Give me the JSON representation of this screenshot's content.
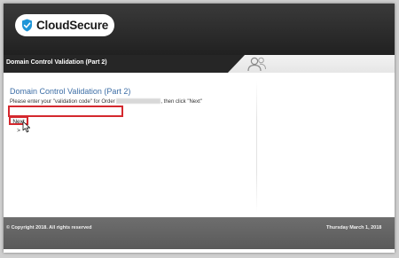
{
  "brand": {
    "name": "CloudSecure",
    "accent": "#1f96d8"
  },
  "titlebar": {
    "title": "Domain Control Validation (Part 2)",
    "icon": "users-icon"
  },
  "main": {
    "heading": "Domain Control Validation (Part 2)",
    "instruction_prefix": "Please enter your \"validation code\" for Order",
    "instruction_suffix": ", then click \"Next\"",
    "code_input": {
      "value": "",
      "placeholder": ""
    },
    "next_label": "Next >"
  },
  "footer": {
    "copyright": "© Copyright 2018. All rights reserved",
    "date": "Thursday March 1, 2018"
  },
  "colors": {
    "highlight": "#d4282e",
    "heading": "#3d6ea6"
  }
}
